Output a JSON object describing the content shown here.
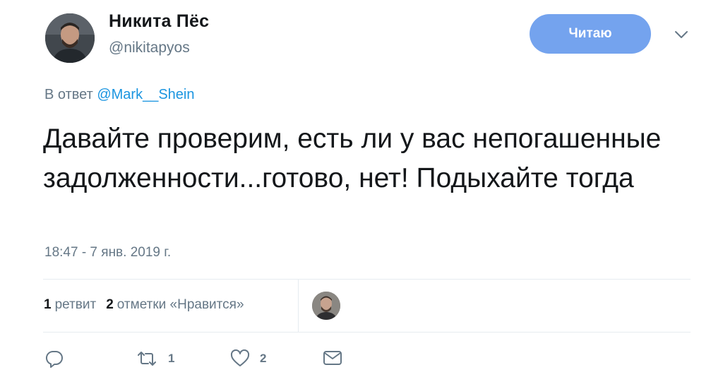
{
  "author": {
    "name": "Никита Пёс",
    "handle": "@nikitapyos"
  },
  "follow_button": {
    "label": "Читаю"
  },
  "reply_to": {
    "prefix": "В ответ",
    "mention": "@Mark__Shein"
  },
  "tweet": {
    "text": "Давайте проверим, есть ли у вас непогашенные задолженности...готово, нет! Подыхайте тогда",
    "timestamp": "18:47 - 7 янв. 2019 г."
  },
  "stats": {
    "retweets_count": "1",
    "retweets_label": "ретвит",
    "likes_count": "2",
    "likes_label": "отметки «Нравится»"
  },
  "actions": {
    "retweet_count": "1",
    "like_count": "2"
  },
  "colors": {
    "accent": "#74a3ee",
    "link": "#1b95e0",
    "muted": "#657786"
  },
  "icons": [
    "chevron-down-icon",
    "reply-icon",
    "retweet-icon",
    "heart-icon",
    "message-icon"
  ]
}
